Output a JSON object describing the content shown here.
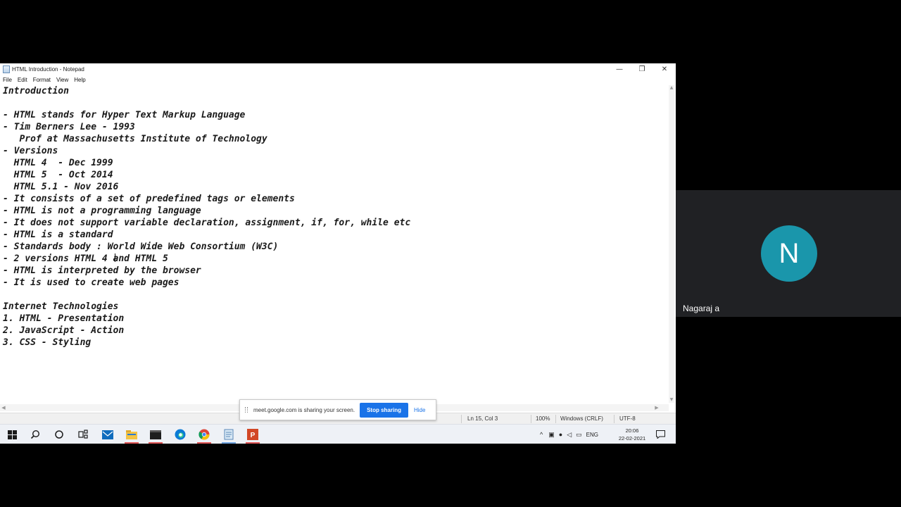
{
  "notepad": {
    "title": "HTML Introduction - Notepad",
    "menu": [
      "File",
      "Edit",
      "Format",
      "View",
      "Help"
    ],
    "window_controls": {
      "minimize": "—",
      "restore": "❐",
      "close": "✕"
    },
    "lines": [
      "Introduction",
      "",
      "- HTML stands for Hyper Text Markup Language",
      "- Tim Berners Lee - 1993",
      "   Prof at Massachusetts Institute of Technology",
      "- Versions",
      "  HTML 4  - Dec 1999",
      "  HTML 5  - Oct 2014",
      "  HTML 5.1 - Nov 2016",
      "- It consists of a set of predefined tags or elements",
      "- HTML is not a programming language",
      "- It does not support variable declaration, assignment, if, for, while etc",
      "- HTML is a standard",
      "- Standards body : World Wide Web Consortium (W3C)",
      "- 2 versions HTML 4 and HTML 5",
      "- HTML is interpreted by the browser",
      "- It is used to create web pages",
      "",
      "Internet Technologies",
      "1. HTML - Presentation",
      "2. JavaScript - Action",
      "3. CSS - Styling"
    ],
    "status": {
      "position": "Ln 15, Col 3",
      "zoom": "100%",
      "line_ending": "Windows (CRLF)",
      "encoding": "UTF-8"
    }
  },
  "share_banner": {
    "text": "meet.google.com is sharing your screen.",
    "stop_label": "Stop sharing",
    "hide_label": "Hide"
  },
  "taskbar": {
    "icons": [
      "windows-start-icon",
      "search-icon",
      "cortana-icon",
      "task-view-icon",
      "mail-icon",
      "file-explorer-icon",
      "terminal-icon",
      "edge-icon",
      "chrome-icon",
      "notepad-icon",
      "powerpoint-icon"
    ],
    "tray_language": "ENG",
    "clock_time": "20:06",
    "clock_date": "22-02-2021"
  },
  "participant": {
    "initial": "N",
    "name": "Nagaraj a",
    "avatar_color": "#1a96ab"
  }
}
